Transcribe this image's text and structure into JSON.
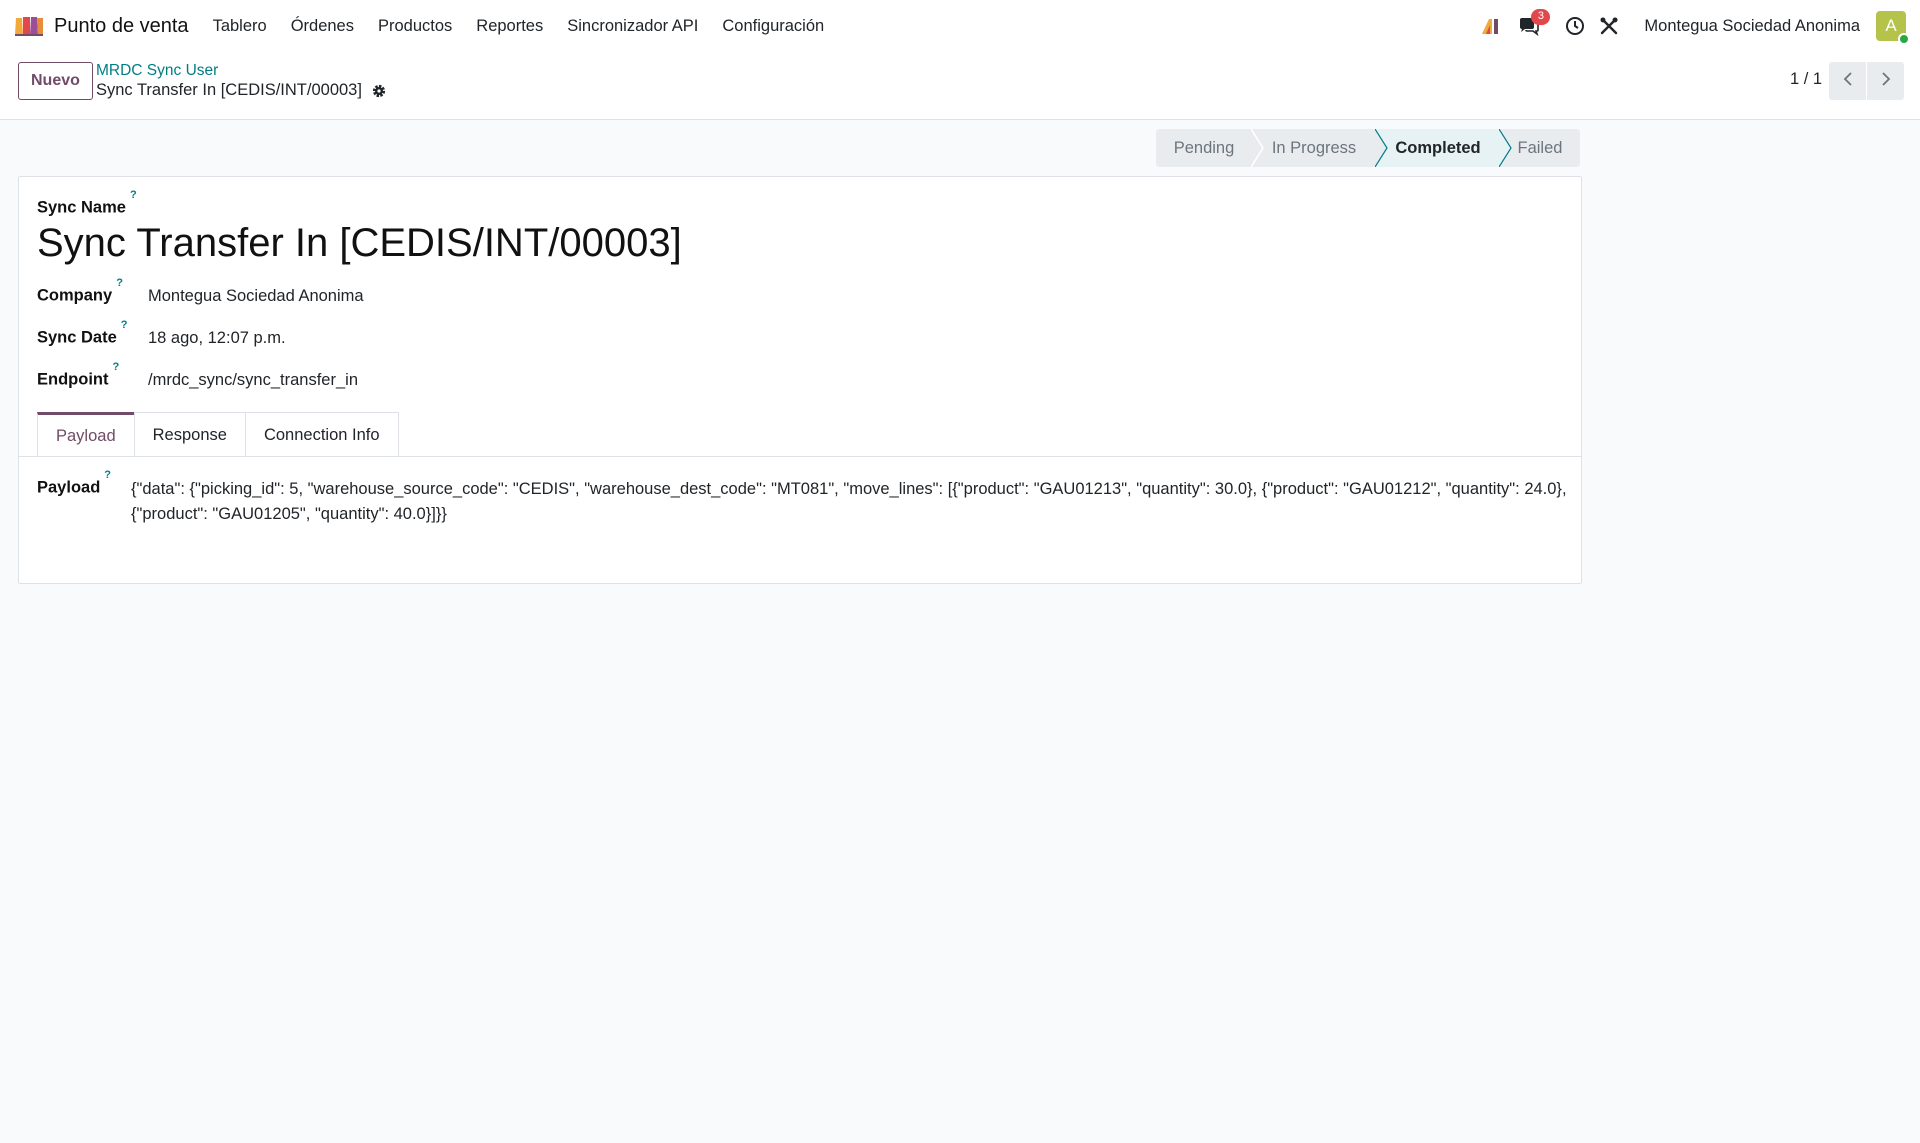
{
  "navbar": {
    "app_name": "Punto de venta",
    "menu": [
      "Tablero",
      "Órdenes",
      "Productos",
      "Reportes",
      "Sincronizador API",
      "Configuración"
    ],
    "messages_count": "3",
    "company": "Montegua Sociedad Anonima",
    "avatar_letter": "A"
  },
  "control_panel": {
    "new_button": "Nuevo",
    "breadcrumb_parent": "MRDC Sync User",
    "breadcrumb_current": "Sync Transfer In [CEDIS/INT/00003]",
    "pager": "1 / 1"
  },
  "statusbar": {
    "stages": [
      "Pending",
      "In Progress",
      "Completed",
      "Failed"
    ],
    "active": "Completed"
  },
  "form": {
    "sync_name_label": "Sync Name",
    "sync_name": "Sync Transfer In [CEDIS/INT/00003]",
    "company_label": "Company",
    "company": "Montegua Sociedad Anonima",
    "sync_date_label": "Sync Date",
    "sync_date": "18 ago, 12:07 p.m.",
    "endpoint_label": "Endpoint",
    "endpoint": "/mrdc_sync/sync_transfer_in",
    "help_mark": "?",
    "tabs": [
      "Payload",
      "Response",
      "Connection Info"
    ],
    "payload_label": "Payload",
    "payload": "{\"data\": {\"picking_id\": 5, \"warehouse_source_code\": \"CEDIS\", \"warehouse_dest_code\": \"MT081\", \"move_lines\": [{\"product\": \"GAU01213\", \"quantity\": 30.0}, {\"product\": \"GAU01212\", \"quantity\": 24.0}, {\"product\": \"GAU01205\", \"quantity\": 40.0}]}}"
  },
  "colors": {
    "brand": "#714b67",
    "link": "#017e84",
    "badge": "#e2474b",
    "avatar": "#b5c34a"
  },
  "icons": [
    "app-logo-icon",
    "ai-icon",
    "chat-icon",
    "clock-icon",
    "tools-icon",
    "gear-icon",
    "chevron-left-icon",
    "chevron-right-icon"
  ]
}
